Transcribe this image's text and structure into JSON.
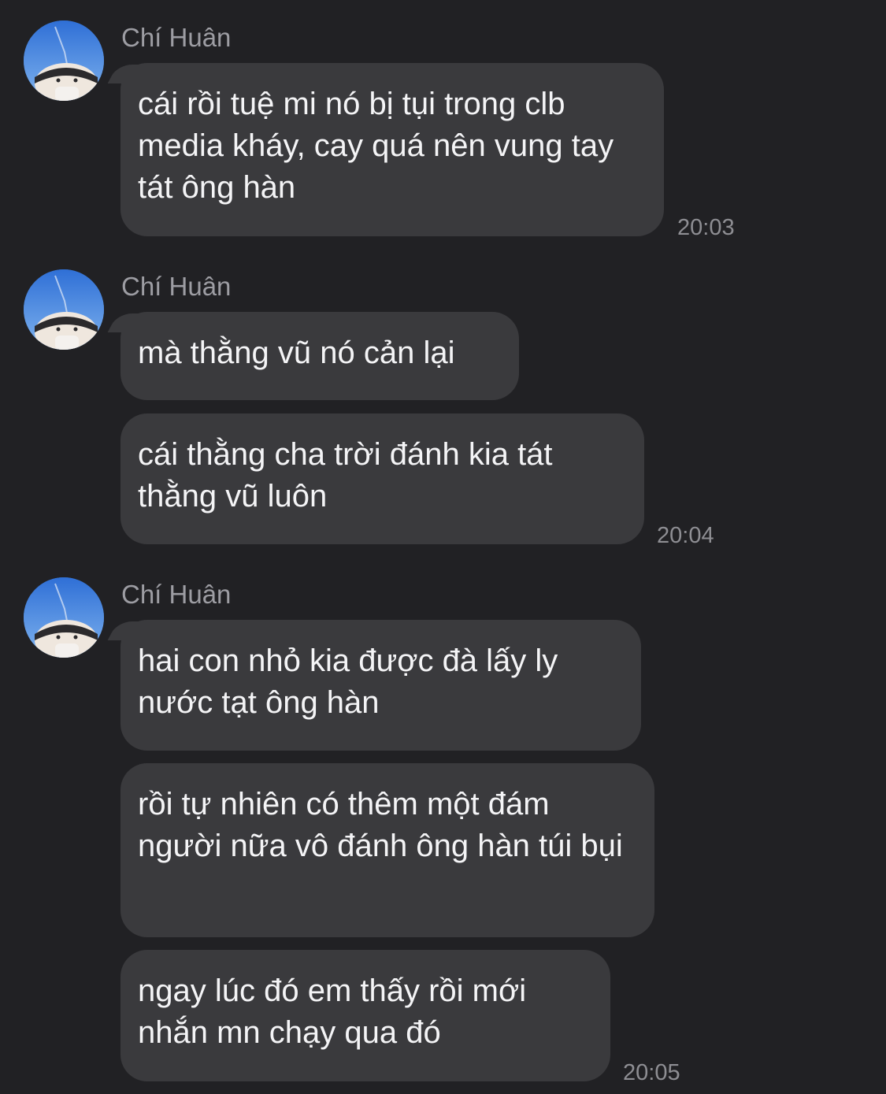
{
  "messages": [
    {
      "sender": "Chí Huân",
      "avatar": "user-avatar-photo",
      "bubbles": [
        "cái rồi tuệ mi nó bị tụi trong clb media kháy, cay quá nên vung tay tát ông hàn"
      ],
      "time": "20:03"
    },
    {
      "sender": "Chí Huân",
      "avatar": "user-avatar-photo",
      "bubbles": [
        "mà thằng vũ nó cản lại",
        "cái thằng cha trời đánh kia tát thằng vũ luôn"
      ],
      "time": "20:04"
    },
    {
      "sender": "Chí Huân",
      "avatar": "user-avatar-photo",
      "bubbles": [
        "hai con nhỏ kia được đà lấy ly nước tạt ông hàn",
        "rồi tự nhiên có thêm một đám người nữa vô đánh ông hàn túi bụi",
        "ngay lúc đó em thấy rồi mới nhắn mn chạy qua đó"
      ],
      "time": "20:05"
    }
  ],
  "colors": {
    "background": "#212124",
    "bubble": "#3a3a3d",
    "sender_name": "#9d9da3",
    "timestamp": "#8e8e93",
    "text": "#f4f4f6"
  }
}
